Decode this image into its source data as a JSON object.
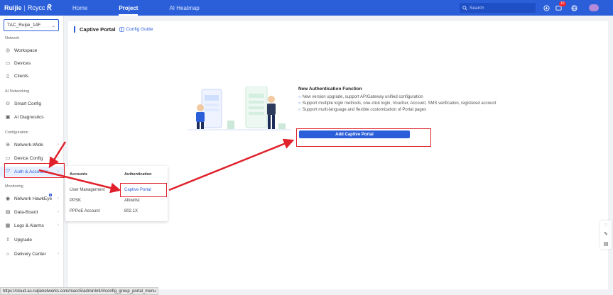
{
  "topbar": {
    "logo_brand": "Ruijie",
    "logo_sub": "Rcycc",
    "tabs": [
      {
        "label": "Home"
      },
      {
        "label": "Project"
      },
      {
        "label": "AI Heatmap"
      }
    ],
    "search_placeholder": "Search",
    "notification_count": "10"
  },
  "sidebar": {
    "project": "TAC_Ruijie_14F",
    "sections": {
      "network": "Network",
      "ai_networking": "AI Networking",
      "configuration": "Configuration",
      "monitoring": "Monitoring"
    },
    "items": [
      {
        "label": "Workspace"
      },
      {
        "label": "Devices"
      },
      {
        "label": "Clients"
      },
      {
        "label": "Smart Config"
      },
      {
        "label": "AI Diagnostics"
      },
      {
        "label": "Network-Wide"
      },
      {
        "label": "Device Config"
      },
      {
        "label": "Auth & Accounts"
      },
      {
        "label": "Network HawkEye"
      },
      {
        "label": "Data-Board"
      },
      {
        "label": "Logs & Alarms"
      },
      {
        "label": "Upgrade"
      },
      {
        "label": "Delivery Center"
      }
    ]
  },
  "main": {
    "title": "Captive Portal",
    "config_guide": "Config Guide",
    "info_title": "New Authentication Function",
    "info_lines": [
      "New version upgrade, support AP/Gateway unified configuration",
      "Support multiple login methods, one-click login, Voucher, Account, SMS verification, registered account",
      "Support multi-language and flexible customization of Portal pages"
    ],
    "add_button": "Add Captive Portal"
  },
  "popup": {
    "accounts_header": "Accounts",
    "auth_header": "Authentication",
    "accounts_items": [
      "User Management",
      "PPSK",
      "PPPoE Account"
    ],
    "auth_items": [
      "Captive Portal",
      "Allowlist",
      "802.1X"
    ]
  },
  "statusbar": {
    "url": "https://cloud-as.ruijienetworks.com/macc5/adminIntl/#/config_group_portal_menu"
  },
  "colors": {
    "brand": "#2b5fd9",
    "annotation": "#e0202a"
  }
}
